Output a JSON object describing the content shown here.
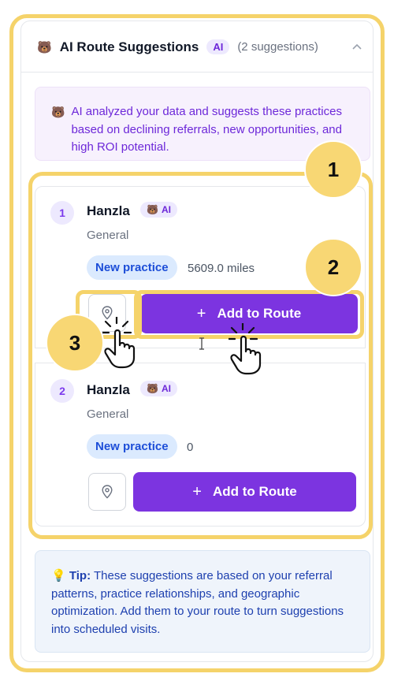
{
  "header": {
    "title": "AI Route Suggestions",
    "ai_badge": "AI",
    "count": "(2 suggestions)"
  },
  "info": {
    "text": "AI analyzed your data and suggests these practices based on declining referrals, new opportunities, and high ROI potential."
  },
  "suggestions": [
    {
      "index": "1",
      "name": "Hanzla",
      "badge": "AI",
      "category": "General",
      "tag": "New practice",
      "distance": "5609.0 miles",
      "button": "Add to Route"
    },
    {
      "index": "2",
      "name": "Hanzla",
      "badge": "AI",
      "category": "General",
      "tag": "New practice",
      "distance": "0",
      "button": "Add to Route"
    }
  ],
  "tip": {
    "label": "Tip:",
    "text": "These suggestions are based on your referral patterns, practice relationships, and geographic optimization. Add them to your route to turn suggestions into scheduled visits."
  },
  "steps": [
    "1",
    "2",
    "3"
  ],
  "icons": {
    "bear": "bear-face-icon",
    "chevron": "chevron-up-icon",
    "pin": "map-pin-icon",
    "plus": "plus-icon",
    "bulb": "lightbulb-icon",
    "cursor": "hand-pointer-icon"
  },
  "colors": {
    "accent": "#7c34e0",
    "highlight": "#f5d36a",
    "step_fill": "#f8d774"
  }
}
